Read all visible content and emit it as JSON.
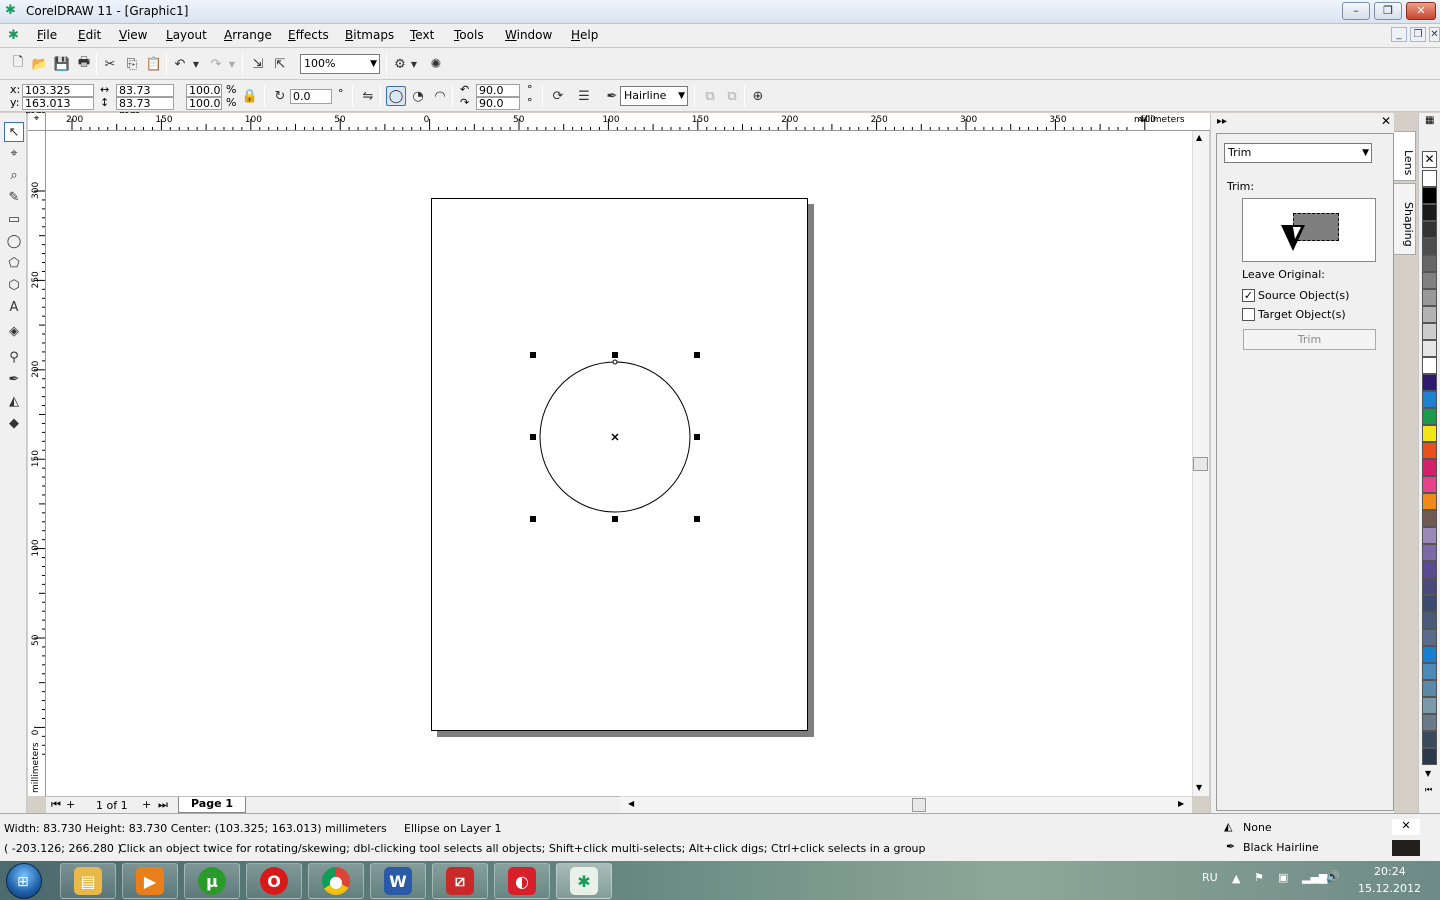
{
  "window": {
    "title": "CorelDRAW 11 - [Graphic1]",
    "min_label": "–",
    "max_label": "❐",
    "close_label": "✕"
  },
  "menu": {
    "items": [
      "File",
      "Edit",
      "View",
      "Layout",
      "Arrange",
      "Effects",
      "Bitmaps",
      "Text",
      "Tools",
      "Window",
      "Help"
    ],
    "mdi_min": "_",
    "mdi_restore": "❐",
    "mdi_close": "✕"
  },
  "standard_toolbar": {
    "zoom_value": "100%"
  },
  "property_bar": {
    "x_label": "x:",
    "y_label": "y:",
    "x_value": "103.325 mm",
    "y_value": "163.013 mm",
    "width_value": "83.73 mm",
    "height_value": "83.73 mm",
    "scale_x": "100.0",
    "scale_y": "100.0",
    "pct": "%",
    "rotation_value": "0.0",
    "degree": "°",
    "start_angle": "90.0",
    "end_angle": "90.0",
    "outline_width": "Hairline"
  },
  "rulers": {
    "unit": "millimeters",
    "h_ticks": [
      "200",
      "150",
      "100",
      "50",
      "0",
      "50",
      "100",
      "150",
      "200",
      "250",
      "300",
      "350",
      "400"
    ],
    "v_ticks": [
      "300",
      "250",
      "200",
      "150",
      "100",
      "50",
      "0"
    ]
  },
  "page_nav": {
    "counter": "1 of 1",
    "page_tab": "Page 1"
  },
  "docker": {
    "mode": "Trim",
    "trim_label": "Trim:",
    "leave_original": "Leave Original:",
    "source_label": "Source Object(s)",
    "source_checked": true,
    "target_label": "Target Object(s)",
    "target_checked": false,
    "apply_button": "Trim",
    "tabs": [
      "Lens",
      "Shaping"
    ]
  },
  "palette": {
    "colors": [
      "#ffffff",
      "#000000",
      "#1a1a1a",
      "#333333",
      "#4d4d4d",
      "#666666",
      "#808080",
      "#999999",
      "#b3b3b3",
      "#cccccc",
      "#e6e6e6",
      "#ffffff",
      "#2e1a6e",
      "#1f7fd1",
      "#1a9a4a",
      "#f3e51a",
      "#e8501e",
      "#d4206a",
      "#e8408a",
      "#f28a1a",
      "#6e5a50",
      "#9a88b8",
      "#7c6aa8",
      "#5a4c90",
      "#4a4a7a",
      "#3e4a6e",
      "#4a5a7a",
      "#5a6a8a",
      "#1a7fd1",
      "#4a8ab8",
      "#5a8aa8",
      "#7a9aa8",
      "#6a7a88",
      "#3a4a5a",
      "#2a3a4a"
    ]
  },
  "status": {
    "dimensions": "Width: 83.730  Height: 83.730  Center: (103.325; 163.013)  millimeters",
    "object_info": "Ellipse on Layer 1",
    "cursor_coords": "( -203.126; 266.280 )",
    "hint": "Click an object twice for rotating/skewing; dbl-clicking tool selects all objects; Shift+click multi-selects; Alt+click digs; Ctrl+click selects in a group",
    "fill_label": "None",
    "outline_label": "Black  Hairline"
  },
  "taskbar": {
    "lang": "RU",
    "time": "20:24",
    "date": "15.12.2012"
  }
}
